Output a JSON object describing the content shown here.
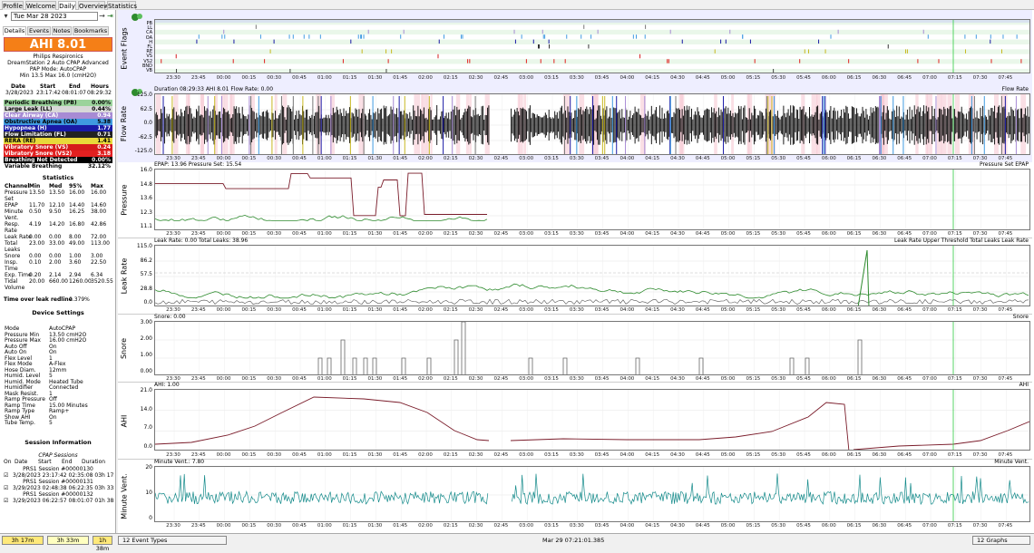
{
  "tabs": [
    "Profile",
    "Welcome",
    "Daily",
    "Overview",
    "Statistics"
  ],
  "date_selector": {
    "value": "Tue Mar 28 2023",
    "prev": "←",
    "next": "→",
    "jump": "⇥"
  },
  "sub_tabs": [
    "Details",
    "Events",
    "Notes",
    "Bookmarks"
  ],
  "ahi_label": "AHI 8.01",
  "machine": {
    "brand": "Philips Respironics",
    "model": "DreamStation 2 Auto CPAP Advanced",
    "pap_mode": "PAP Mode: AutoCPAP",
    "pressure": "Min 13.5 Max 16.0 (cmH2O)"
  },
  "session_summary": {
    "headers": [
      "Date",
      "Start",
      "End",
      "Hours"
    ],
    "row": [
      "3/28/2023",
      "23:17:42",
      "08:01:07",
      "08:29:32"
    ]
  },
  "events": [
    {
      "label": "Periodic Breathing (PB)",
      "value": "0.00%",
      "bg": "#9bd39b",
      "fg": "#000"
    },
    {
      "label": "Large Leak (LL)",
      "value": "0.44%",
      "bg": "#d8d8d8",
      "fg": "#000"
    },
    {
      "label": "Clear Airway (CA)",
      "value": "0.94",
      "bg": "#a78bd4",
      "fg": "#fff"
    },
    {
      "label": "Obstructive Apnea (OA)",
      "value": "5.38",
      "bg": "#3f9ae0",
      "fg": "#000"
    },
    {
      "label": "Hypopnea (H)",
      "value": "1.77",
      "bg": "#1a1aa6",
      "fg": "#fff"
    },
    {
      "label": "Flow Limitation (FL)",
      "value": "0.71",
      "bg": "#222222",
      "fg": "#fff"
    },
    {
      "label": "RERA (RE)",
      "value": "1.41",
      "bg": "#e8d93a",
      "fg": "#000"
    },
    {
      "label": "Vibratory Snore (VS)",
      "value": "0.24",
      "bg": "#d61b1b",
      "fg": "#fff"
    },
    {
      "label": "Vibratory Snore (VS2)",
      "value": "3.18",
      "bg": "#e22020",
      "fg": "#fff"
    },
    {
      "label": "Breathing Not Detected",
      "value": "0.00%",
      "bg": "#000000",
      "fg": "#fff"
    },
    {
      "label": "Variable Breathing",
      "value": "32.12%",
      "bg": "#ffffff",
      "fg": "#000"
    }
  ],
  "statistics": {
    "title": "Statistics",
    "headers": [
      "Channel",
      "Min",
      "Med",
      "95%",
      "Max"
    ],
    "rows": [
      [
        "Pressure",
        "13.50",
        "13.50",
        "16.00",
        "16.00"
      ],
      [
        "Set",
        "",
        "",
        "",
        ""
      ],
      [
        "EPAP",
        "11.70",
        "12.10",
        "14.40",
        "14.60"
      ],
      [
        "Minute",
        "0.50",
        "9.50",
        "16.25",
        "38.00"
      ],
      [
        "Vent.",
        "",
        "",
        "",
        ""
      ],
      [
        "Resp.",
        "4.19",
        "14.20",
        "16.80",
        "42.86"
      ],
      [
        "Rate",
        "",
        "",
        "",
        ""
      ],
      [
        "Leak Rate",
        "0.00",
        "0.00",
        "8.00",
        "72.00"
      ],
      [
        "Total",
        "23.00",
        "33.00",
        "49.00",
        "113.00"
      ],
      [
        "Leaks",
        "",
        "",
        "",
        ""
      ],
      [
        "Snore",
        "0.00",
        "0.00",
        "1.00",
        "3.00"
      ],
      [
        "Insp.",
        "0.10",
        "2.00",
        "3.60",
        "22.50"
      ],
      [
        "Time",
        "",
        "",
        "",
        ""
      ],
      [
        "Exp. Time",
        "0.20",
        "2.14",
        "2.94",
        "6.34"
      ],
      [
        "Tidal",
        "20.00",
        "660.00",
        "1260.00",
        "3520.55"
      ],
      [
        "Volume",
        "",
        "",
        "",
        ""
      ]
    ]
  },
  "time_over_leak": {
    "label": "Time over leak redline",
    "value": "0.379%"
  },
  "device_settings": {
    "title": "Device Settings",
    "rows": [
      [
        "Mode",
        "AutoCPAP"
      ],
      [
        "Pressure Min",
        "13.50 cmH2O"
      ],
      [
        "Pressure Max",
        "16.00 cmH2O"
      ],
      [
        "Auto Off",
        "On"
      ],
      [
        "Auto On",
        "On"
      ],
      [
        "Flex Level",
        "1"
      ],
      [
        "Flex Mode",
        "A-Flex"
      ],
      [
        "Hose Diam.",
        "12mm"
      ],
      [
        "Humid. Level",
        "5"
      ],
      [
        "Humid. Mode",
        "Heated Tube"
      ],
      [
        "Humidifier",
        "Connected"
      ],
      [
        "Mask Resist.",
        "1"
      ],
      [
        "Ramp Pressure",
        "Off"
      ],
      [
        "Ramp Time",
        "15.00 Minutes"
      ],
      [
        "Ramp Type",
        "Ramp+"
      ],
      [
        "Show AHI",
        "On"
      ],
      [
        "Tube Temp.",
        "5"
      ]
    ]
  },
  "session_info": {
    "title": "Session Information",
    "subtitle": "CPAP Sessions",
    "headers": [
      "On",
      "Date",
      "Start",
      "End",
      "Duration"
    ],
    "sessions": [
      {
        "name": "PRS1 Session #00000130",
        "row": "3/28/2023 23:17:42 02:35:08 03h 17m 26s"
      },
      {
        "name": "PRS1 Session #00000131",
        "row": "3/29/2023 02:48:38 06:22:35 03h 33m 57s"
      },
      {
        "name": "PRS1 Session #00000132",
        "row": "3/29/2023 06:22:57 08:01:07 01h 38m 10s"
      }
    ]
  },
  "bottom": {
    "btn1": "3h 17m",
    "btn2": "3h 33m",
    "btn3": "1h 38m",
    "event_types": "12 Event Types",
    "timestamp": "Mar 29 07:21:01.385",
    "graphs": "12 Graphs"
  },
  "x_ticks": [
    "23:30",
    "23:45",
    "00:00",
    "00:15",
    "00:30",
    "00:45",
    "01:00",
    "01:15",
    "01:30",
    "01:45",
    "02:00",
    "02:15",
    "02:30",
    "02:45",
    "03:00",
    "03:15",
    "03:30",
    "03:45",
    "04:00",
    "04:15",
    "04:30",
    "04:45",
    "05:00",
    "05:15",
    "05:30",
    "05:45",
    "06:00",
    "06:15",
    "06:30",
    "06:45",
    "07:00",
    "07:15",
    "07:30",
    "07:45"
  ],
  "graphs": {
    "flags": {
      "label": "Event Flags",
      "flags": [
        "PB",
        "LL",
        "CA",
        "OA",
        "H",
        "FL",
        "RE",
        "VS",
        "VS2",
        "BND",
        "VB"
      ]
    },
    "flow": {
      "label": "Flow Rate",
      "title": "Duration 08:29:33 AHI 8.01 Flow Rate: 0.00",
      "legend": "Flow Rate",
      "yticks": [
        "125.0",
        "62.5",
        "0.0",
        "-62.5",
        "-125.0"
      ]
    },
    "pressure": {
      "label": "Pressure",
      "title": "EPAP: 13.96 Pressure Set: 15.54",
      "legend": "Pressure Set  EPAP",
      "yticks": [
        "16.0",
        "14.8",
        "13.6",
        "12.3",
        "11.1"
      ]
    },
    "leak": {
      "label": "Leak Rate",
      "title": "Leak Rate: 0.00 Total Leaks: 38.96",
      "legend": "Leak Rate Upper Threshold  Total Leaks  Leak Rate",
      "yticks": [
        "115.0",
        "86.2",
        "57.5",
        "28.8",
        "0.0"
      ]
    },
    "snore": {
      "label": "Snore",
      "title": "Snore: 0.00",
      "legend": "Snore",
      "yticks": [
        "3.00",
        "2.00",
        "1.00",
        "0.00"
      ]
    },
    "ahi": {
      "label": "AHI",
      "title": "AHI: 1.00",
      "legend": "AHI",
      "yticks": [
        "21.0",
        "14.0",
        "7.0",
        "0.0"
      ]
    },
    "minvent": {
      "label": "Minute Vent.",
      "title": "Minute Vent.: 7.80",
      "legend": "Minute Vent.",
      "yticks": [
        "20",
        "10",
        "0"
      ]
    }
  },
  "colors": {
    "flow": "#000000",
    "pressure_set": "#7a1c2a",
    "epap": "#2e8b2e",
    "leak": "#2e8b2e",
    "total_leak": "#555555",
    "snore": "#666666",
    "ahi": "#7a1c2a",
    "minvent": "#138a8a",
    "cursor": "#2ecc40"
  }
}
